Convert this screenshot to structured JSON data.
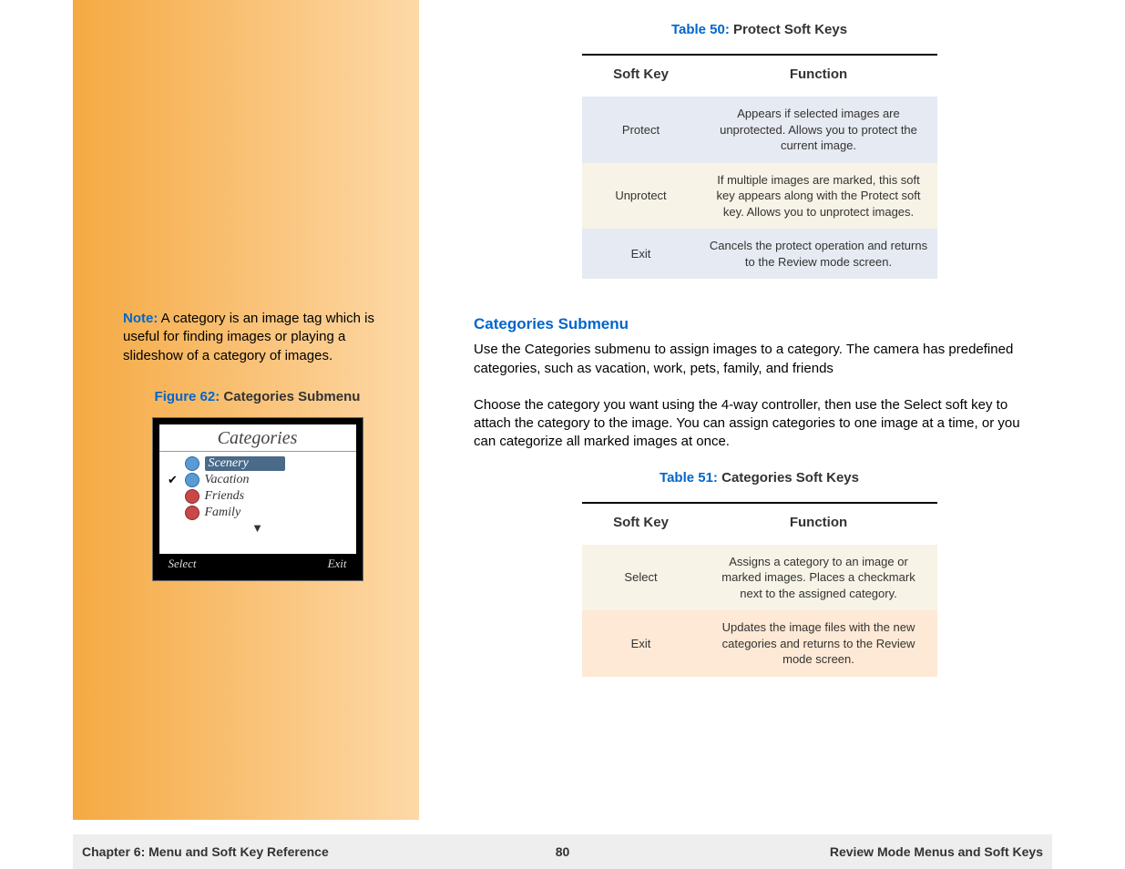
{
  "sidebar": {
    "note_label": "Note:",
    "note_text": " A category is an image tag which is useful for finding images or playing a slideshow of a category of images.",
    "figure_num": "Figure 62:",
    "figure_title": " Categories Submenu",
    "screen": {
      "title": "Categories",
      "items": [
        {
          "label": "Scenery",
          "checked": false,
          "selected": true,
          "icon": "blue"
        },
        {
          "label": "Vacation",
          "checked": true,
          "selected": false,
          "icon": "blue"
        },
        {
          "label": "Friends",
          "checked": false,
          "selected": false,
          "icon": "red"
        },
        {
          "label": "Family",
          "checked": false,
          "selected": false,
          "icon": "red"
        }
      ],
      "left_key": "Select",
      "right_key": "Exit"
    }
  },
  "table50": {
    "caption_num": "Table 50:",
    "caption_title": " Protect Soft Keys",
    "col1": "Soft Key",
    "col2": "Function",
    "rows": [
      {
        "key": "Protect",
        "fn": "Appears if selected images are unprotected. Allows you to protect the current image."
      },
      {
        "key": "Unprotect",
        "fn": "If multiple images are marked, this soft key appears along with the Protect soft key. Allows you to unprotect images."
      },
      {
        "key": "Exit",
        "fn": "Cancels the protect operation and returns to the Review mode screen."
      }
    ]
  },
  "section": {
    "heading": "Categories Submenu",
    "p1": "Use the Categories submenu to assign images to a category. The camera has predefined categories, such as vacation, work, pets, family, and friends",
    "p2": "Choose the category you want using the 4-way controller, then use the Select soft key to attach the category to the image. You can assign categories to one image at a time, or you can categorize all marked images at once."
  },
  "table51": {
    "caption_num": "Table 51:",
    "caption_title": " Categories Soft Keys",
    "col1": "Soft Key",
    "col2": "Function",
    "rows": [
      {
        "key": "Select",
        "fn": "Assigns a category to an image or marked images. Places a checkmark next to the assigned category."
      },
      {
        "key": "Exit",
        "fn": "Updates the image files with the new categories and returns to the Review mode screen."
      }
    ]
  },
  "footer": {
    "left": "Chapter 6: Menu and Soft Key Reference",
    "center": "80",
    "right": "Review Mode Menus and Soft Keys"
  }
}
